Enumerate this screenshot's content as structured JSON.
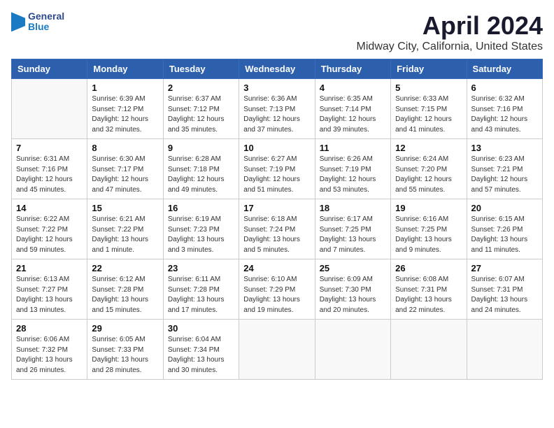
{
  "logo": {
    "line1": "General",
    "line2": "Blue"
  },
  "title": "April 2024",
  "location": "Midway City, California, United States",
  "headers": [
    "Sunday",
    "Monday",
    "Tuesday",
    "Wednesday",
    "Thursday",
    "Friday",
    "Saturday"
  ],
  "weeks": [
    [
      {
        "day": "",
        "info": ""
      },
      {
        "day": "1",
        "info": "Sunrise: 6:39 AM\nSunset: 7:12 PM\nDaylight: 12 hours\nand 32 minutes."
      },
      {
        "day": "2",
        "info": "Sunrise: 6:37 AM\nSunset: 7:12 PM\nDaylight: 12 hours\nand 35 minutes."
      },
      {
        "day": "3",
        "info": "Sunrise: 6:36 AM\nSunset: 7:13 PM\nDaylight: 12 hours\nand 37 minutes."
      },
      {
        "day": "4",
        "info": "Sunrise: 6:35 AM\nSunset: 7:14 PM\nDaylight: 12 hours\nand 39 minutes."
      },
      {
        "day": "5",
        "info": "Sunrise: 6:33 AM\nSunset: 7:15 PM\nDaylight: 12 hours\nand 41 minutes."
      },
      {
        "day": "6",
        "info": "Sunrise: 6:32 AM\nSunset: 7:16 PM\nDaylight: 12 hours\nand 43 minutes."
      }
    ],
    [
      {
        "day": "7",
        "info": "Sunrise: 6:31 AM\nSunset: 7:16 PM\nDaylight: 12 hours\nand 45 minutes."
      },
      {
        "day": "8",
        "info": "Sunrise: 6:30 AM\nSunset: 7:17 PM\nDaylight: 12 hours\nand 47 minutes."
      },
      {
        "day": "9",
        "info": "Sunrise: 6:28 AM\nSunset: 7:18 PM\nDaylight: 12 hours\nand 49 minutes."
      },
      {
        "day": "10",
        "info": "Sunrise: 6:27 AM\nSunset: 7:19 PM\nDaylight: 12 hours\nand 51 minutes."
      },
      {
        "day": "11",
        "info": "Sunrise: 6:26 AM\nSunset: 7:19 PM\nDaylight: 12 hours\nand 53 minutes."
      },
      {
        "day": "12",
        "info": "Sunrise: 6:24 AM\nSunset: 7:20 PM\nDaylight: 12 hours\nand 55 minutes."
      },
      {
        "day": "13",
        "info": "Sunrise: 6:23 AM\nSunset: 7:21 PM\nDaylight: 12 hours\nand 57 minutes."
      }
    ],
    [
      {
        "day": "14",
        "info": "Sunrise: 6:22 AM\nSunset: 7:22 PM\nDaylight: 12 hours\nand 59 minutes."
      },
      {
        "day": "15",
        "info": "Sunrise: 6:21 AM\nSunset: 7:22 PM\nDaylight: 13 hours\nand 1 minute."
      },
      {
        "day": "16",
        "info": "Sunrise: 6:19 AM\nSunset: 7:23 PM\nDaylight: 13 hours\nand 3 minutes."
      },
      {
        "day": "17",
        "info": "Sunrise: 6:18 AM\nSunset: 7:24 PM\nDaylight: 13 hours\nand 5 minutes."
      },
      {
        "day": "18",
        "info": "Sunrise: 6:17 AM\nSunset: 7:25 PM\nDaylight: 13 hours\nand 7 minutes."
      },
      {
        "day": "19",
        "info": "Sunrise: 6:16 AM\nSunset: 7:25 PM\nDaylight: 13 hours\nand 9 minutes."
      },
      {
        "day": "20",
        "info": "Sunrise: 6:15 AM\nSunset: 7:26 PM\nDaylight: 13 hours\nand 11 minutes."
      }
    ],
    [
      {
        "day": "21",
        "info": "Sunrise: 6:13 AM\nSunset: 7:27 PM\nDaylight: 13 hours\nand 13 minutes."
      },
      {
        "day": "22",
        "info": "Sunrise: 6:12 AM\nSunset: 7:28 PM\nDaylight: 13 hours\nand 15 minutes."
      },
      {
        "day": "23",
        "info": "Sunrise: 6:11 AM\nSunset: 7:28 PM\nDaylight: 13 hours\nand 17 minutes."
      },
      {
        "day": "24",
        "info": "Sunrise: 6:10 AM\nSunset: 7:29 PM\nDaylight: 13 hours\nand 19 minutes."
      },
      {
        "day": "25",
        "info": "Sunrise: 6:09 AM\nSunset: 7:30 PM\nDaylight: 13 hours\nand 20 minutes."
      },
      {
        "day": "26",
        "info": "Sunrise: 6:08 AM\nSunset: 7:31 PM\nDaylight: 13 hours\nand 22 minutes."
      },
      {
        "day": "27",
        "info": "Sunrise: 6:07 AM\nSunset: 7:31 PM\nDaylight: 13 hours\nand 24 minutes."
      }
    ],
    [
      {
        "day": "28",
        "info": "Sunrise: 6:06 AM\nSunset: 7:32 PM\nDaylight: 13 hours\nand 26 minutes."
      },
      {
        "day": "29",
        "info": "Sunrise: 6:05 AM\nSunset: 7:33 PM\nDaylight: 13 hours\nand 28 minutes."
      },
      {
        "day": "30",
        "info": "Sunrise: 6:04 AM\nSunset: 7:34 PM\nDaylight: 13 hours\nand 30 minutes."
      },
      {
        "day": "",
        "info": ""
      },
      {
        "day": "",
        "info": ""
      },
      {
        "day": "",
        "info": ""
      },
      {
        "day": "",
        "info": ""
      }
    ]
  ]
}
